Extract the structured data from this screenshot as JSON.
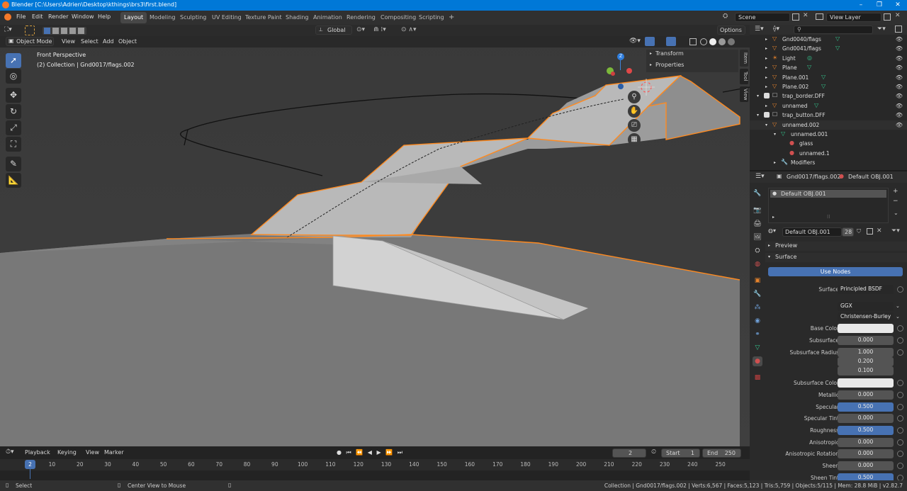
{
  "window": {
    "title": "Blender [C:\\Users\\Adrien\\Desktop\\kthings\\brs3\\first.blend]",
    "min": "–",
    "max": "❐",
    "close": "✕"
  },
  "menus": [
    "File",
    "Edit",
    "Render",
    "Window",
    "Help"
  ],
  "workspaces": [
    "Layout",
    "Modeling",
    "Sculpting",
    "UV Editing",
    "Texture Paint",
    "Shading",
    "Animation",
    "Rendering",
    "Compositing",
    "Scripting"
  ],
  "workspace_add": "+",
  "scene": {
    "label": "Scene",
    "view_layer": "View Layer"
  },
  "viewport": {
    "mode": "Object Mode",
    "menu": [
      "View",
      "Select",
      "Add",
      "Object"
    ],
    "orientation": "Global",
    "options": "Options",
    "overlay_title": "Front Perspective",
    "overlay_sub": "(2) Collection | Gnd0017/flags.002",
    "n_panel": {
      "transform": "Transform",
      "properties": "Properties"
    },
    "side_tabs": [
      "Item",
      "Tool",
      "View"
    ],
    "gizmo": {
      "z": "Z"
    }
  },
  "outliner": {
    "search_placeholder": "",
    "rows": [
      {
        "name": "Gnd0040/flags",
        "color": "#e8842c"
      },
      {
        "name": "Gnd0041/flags",
        "color": "#e8842c"
      },
      {
        "name": "Light",
        "color": "#e8842c"
      },
      {
        "name": "Plane",
        "color": "#e8842c"
      },
      {
        "name": "Plane.001",
        "color": "#e8842c"
      },
      {
        "name": "Plane.002",
        "color": "#e8842c"
      },
      {
        "name": "trap_border.DFF",
        "color": "#cccccc"
      },
      {
        "name": "unnamed",
        "color": "#e8842c"
      },
      {
        "name": "trap_button.DFF",
        "color": "#cccccc"
      },
      {
        "name": "unnamed.002",
        "color": "#e8842c"
      },
      {
        "name": "unnamed.001",
        "color": "#33c38c"
      },
      {
        "name": "glass",
        "color": "#d05050"
      },
      {
        "name": "unnamed.1",
        "color": "#d05050"
      },
      {
        "name": "Modifiers",
        "color": "#6fa0d8"
      }
    ]
  },
  "properties": {
    "object": "Gnd0017/flags.002",
    "material_header": "Default OBJ.001",
    "slot": "Default OBJ.001",
    "material_name": "Default OBJ.001",
    "users": "28",
    "preview": "Preview",
    "surface": "Surface",
    "use_nodes": "Use Nodes",
    "rows": [
      {
        "label": "Surface",
        "value": "Principled BSDF",
        "kind": "dark"
      },
      {
        "label": "",
        "value": "GGX",
        "kind": "dark"
      },
      {
        "label": "",
        "value": "Christensen-Burley",
        "kind": "dark"
      },
      {
        "label": "Base Color",
        "value": "",
        "kind": "white"
      },
      {
        "label": "Subsurface",
        "value": "0.000",
        "kind": "gray"
      },
      {
        "label": "Subsurface Radius",
        "value": "1.000",
        "kind": "gray"
      },
      {
        "label": "",
        "value": "0.200",
        "kind": "gray"
      },
      {
        "label": "",
        "value": "0.100",
        "kind": "gray"
      },
      {
        "label": "Subsurface Color",
        "value": "",
        "kind": "white"
      },
      {
        "label": "Metallic",
        "value": "0.000",
        "kind": "gray"
      },
      {
        "label": "Specular",
        "value": "0.500",
        "kind": "blue"
      },
      {
        "label": "Specular Tint",
        "value": "0.000",
        "kind": "gray"
      },
      {
        "label": "Roughness",
        "value": "0.500",
        "kind": "blue"
      },
      {
        "label": "Anisotropic",
        "value": "0.000",
        "kind": "gray"
      },
      {
        "label": "Anisotropic Rotation",
        "value": "0.000",
        "kind": "gray"
      },
      {
        "label": "Sheen",
        "value": "0.000",
        "kind": "gray"
      },
      {
        "label": "Sheen Tint",
        "value": "0.500",
        "kind": "blue"
      }
    ]
  },
  "timeline": {
    "menu": [
      "Playback",
      "Keying",
      "View",
      "Marker"
    ],
    "current": "2",
    "start_label": "Start",
    "start": "1",
    "end_label": "End",
    "end": "250",
    "ticks": [
      "2",
      "10",
      "20",
      "30",
      "40",
      "50",
      "60",
      "70",
      "80",
      "90",
      "100",
      "110",
      "120",
      "130",
      "140",
      "150",
      "160",
      "170",
      "180",
      "190",
      "200",
      "210",
      "220",
      "230",
      "240",
      "250"
    ]
  },
  "status": {
    "select": "Select",
    "center": "Center View to Mouse",
    "stats": "Collection | Gnd0017/flags.002 | Verts:6,567 | Faces:5,123 | Tris:5,759 | Objects:5/115 | Mem: 28.8 MiB | v2.82.7"
  }
}
